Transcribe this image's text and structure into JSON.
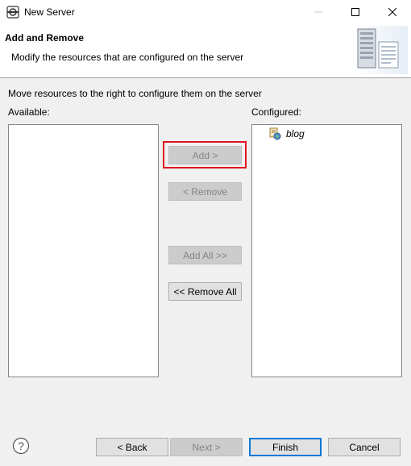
{
  "window": {
    "title": "New Server"
  },
  "header": {
    "title": "Add and Remove",
    "description": "Modify the resources that are configured on the server"
  },
  "instruction": "Move resources to the right to configure them on the server",
  "available": {
    "label": "Available:",
    "items": []
  },
  "configured": {
    "label": "Configured:",
    "items": [
      {
        "label": "blog",
        "icon": "web-project-icon"
      }
    ]
  },
  "transfer_buttons": {
    "add": "Add >",
    "remove": "< Remove",
    "add_all": "Add All >>",
    "remove_all": "<< Remove All"
  },
  "footer_buttons": {
    "back": "< Back",
    "next": "Next >",
    "finish": "Finish",
    "cancel": "Cancel"
  },
  "colors": {
    "highlight": "#e0141e",
    "focus": "#0078d7"
  }
}
